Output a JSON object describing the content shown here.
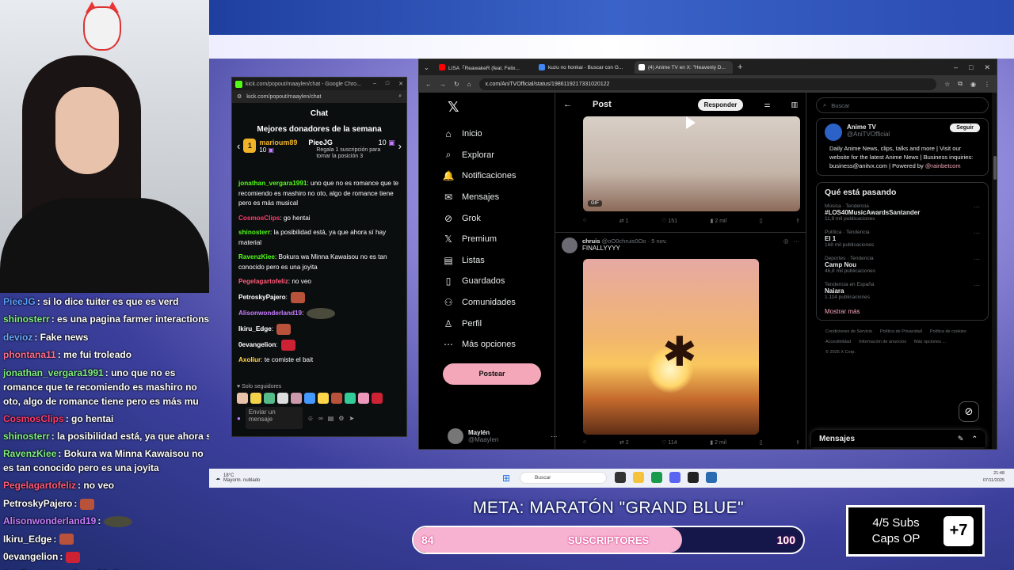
{
  "left_chat": [
    {
      "name": "PieeJG",
      "color": "#5aa0ff",
      "text": ": si lo dice tuiter es que es verd"
    },
    {
      "name": "shinosterr",
      "color": "#7ff07f",
      "text": ": es una pagina farmer interactions"
    },
    {
      "name": "devioz",
      "color": "#6aa9ff",
      "text": ": Fake news"
    },
    {
      "name": "phontana11",
      "color": "#ff6f8f",
      "text": ": me fui troleado"
    },
    {
      "name": "jonathan_vergara1991",
      "color": "#7ff07f",
      "text": ": uno que no es romance que te recomiendo es mashiro no oto, algo de romance tiene pero es más mu"
    },
    {
      "name": "CosmosClips",
      "color": "#ff3b6b",
      "text": ": go hentai"
    },
    {
      "name": "shinosterr",
      "color": "#7ff07f",
      "text": ": la posibilidad está, ya que ahora s"
    },
    {
      "name": "RavenzKiee",
      "color": "#7ff07f",
      "text": ": Bokura wa Minna Kawaisou no es tan conocido pero es una joyita"
    },
    {
      "name": "Pegelagartofeliz",
      "color": "#ff5a7a",
      "text": ": no veo"
    },
    {
      "name": "PetroskyPajero",
      "color": "#ffffff",
      "text": ":"
    },
    {
      "name": "Alisonwonderland19",
      "color": "#c77dff",
      "text": ":"
    },
    {
      "name": "Ikiru_Edge",
      "color": "#ffffff",
      "text": ":"
    },
    {
      "name": "0evangelion",
      "color": "#ffffff",
      "text": ":"
    },
    {
      "name": "Axoliur",
      "color": "#ffd54a",
      "text": ": te comiste el bait"
    }
  ],
  "kick": {
    "title": "kick.com/popout/maaylen/chat - Google Chro...",
    "url": "kick.com/popout/maaylen/chat",
    "header": "Chat",
    "donors_title": "Mejores donadores de la semana",
    "donor1_name": "marioum89",
    "donor1_count": "10",
    "donor2_name": "PieeJG",
    "donor2_count": "10",
    "donor3_text": "Regala 1 suscripción para tomar la posición 3",
    "messages": [
      {
        "name": "jonathan_vergara1991",
        "color": "#53fc18",
        "text": ": uno que no es romance que te recomiendo es mashiro no oto, algo de romance tiene pero es más musical"
      },
      {
        "name": "CosmosClips",
        "color": "#ff3b6b",
        "text": ": go hentai"
      },
      {
        "name": "shinosterr",
        "color": "#53fc18",
        "text": ": la posibilidad está, ya que ahora sí hay material"
      },
      {
        "name": "RavenzKiee",
        "color": "#53fc18",
        "text": ": Bokura wa Minna Kawaisou no es tan conocido pero es una joyita"
      },
      {
        "name": "Pegelagartofeliz",
        "color": "#ff5a7a",
        "text": ": no veo"
      },
      {
        "name": "PetroskyPajero",
        "color": "#ffffff",
        "text": ":"
      },
      {
        "name": "Alisonwonderland19",
        "color": "#c77dff",
        "text": ":"
      },
      {
        "name": "Ikiru_Edge",
        "color": "#ffffff",
        "text": ":"
      },
      {
        "name": "0evangelion",
        "color": "#ffffff",
        "text": ":"
      },
      {
        "name": "Axoliur",
        "color": "#ffd54a",
        "text": ": te comiste el bait"
      }
    ],
    "followers_only": "Solo seguidores",
    "input_placeholder": "Enviar un mensaje"
  },
  "browser": {
    "tabs": [
      {
        "label": "LISA「ReawakeR (feat. Felix...",
        "color": "#ff0000"
      },
      {
        "label": "kuzu no honkai - Buscar con G...",
        "color": "#4285f4"
      },
      {
        "label": "(4) Anime TV en X: \"Heavenly D...",
        "color": "#ffffff"
      }
    ],
    "url": "x.com/AniTVOfficial/status/1986119217331020122"
  },
  "x": {
    "nav": [
      "Inicio",
      "Explorar",
      "Notificaciones",
      "Mensajes",
      "Grok",
      "Premium",
      "Listas",
      "Guardados",
      "Comunidades",
      "Perfil",
      "Más opciones"
    ],
    "post_button": "Postear",
    "user_name": "Maylén",
    "user_handle": "@Maaylen",
    "post_header": "Post",
    "reply_button": "Responder",
    "gif_label": "GIF",
    "t1_actions": [
      "",
      "1",
      "151",
      "2 mil"
    ],
    "t2_author": "chruis",
    "t2_handle": "@oO0chruis0Oo · 5 nov.",
    "t2_text": "FINALLYYYY",
    "t2_actions": [
      "",
      "2",
      "114",
      "2 mil"
    ],
    "search_placeholder": "Buscar",
    "profile_name": "Anime TV",
    "profile_handle": "@AniTVOfficial",
    "follow_button": "Seguir",
    "profile_desc": "Daily Anime News, clips, talks and more | Visit our website for the latest Anime News | Business inquiries: business@anitvx.com | Powered by",
    "profile_link": "@rainbetcom",
    "trends_title": "Qué está pasando",
    "trends": [
      {
        "cat": "Música · Tendencia",
        "title": "#LOS40MusicAwardsSantander",
        "count": "11,9 mil publicaciones"
      },
      {
        "cat": "Política · Tendencia",
        "title": "El 1",
        "count": "168 mil publicaciones"
      },
      {
        "cat": "Deportes · Tendencia",
        "title": "Camp Nou",
        "count": "46,8 mil publicaciones"
      },
      {
        "cat": "Tendencia en España",
        "title": "Naiara",
        "count": "1.114 publicaciones"
      }
    ],
    "show_more": "Mostrar más",
    "footer": [
      "Condiciones de Servicio",
      "Política de Privacidad",
      "Política de cookies",
      "Accesibilidad",
      "Información de anuncios",
      "Más opciones ...",
      "© 2025 X Corp."
    ],
    "messages_bar": "Mensajes"
  },
  "taskbar": {
    "weather_temp": "18°C",
    "weather_desc": "Mayorm. nublado",
    "search": "Buscar",
    "time": "21:48",
    "date": "07/11/2025"
  },
  "goal": {
    "meta_title": "META: MARATÓN \"GRAND BLUE\"",
    "current": "84",
    "target": "100",
    "label": "SUSCRIPTORES",
    "progress": 0.84
  },
  "subs": {
    "line1": "4/5 Subs",
    "line2": "Caps OP",
    "plus": "+7"
  }
}
